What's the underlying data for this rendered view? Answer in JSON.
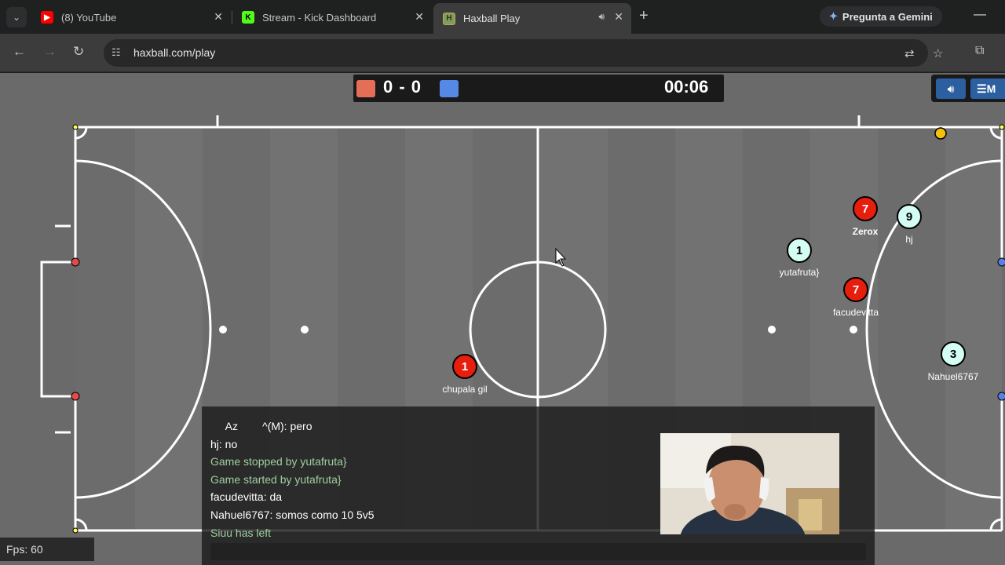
{
  "browser": {
    "tabs": [
      {
        "title": "(8) YouTube",
        "icon": "youtube-icon"
      },
      {
        "title": "Stream - Kick Dashboard",
        "icon": "kick-icon"
      },
      {
        "title": "Haxball Play",
        "icon": "haxball-icon"
      }
    ],
    "gemini_label": "Pregunta a Gemini",
    "url": "haxball.com/play"
  },
  "scoreboard": {
    "score": "0 - 0",
    "time": "00:06",
    "red_color": "#e56e56",
    "blue_color": "#5689e5"
  },
  "menu": {
    "label": "M"
  },
  "players": [
    {
      "number": "1",
      "name": "chupala gil",
      "team": "red"
    },
    {
      "number": "7",
      "name": "Zerox",
      "team": "red"
    },
    {
      "number": "9",
      "name": "hj",
      "team": "blue"
    },
    {
      "number": "1",
      "name": "yutafruta}",
      "team": "blue"
    },
    {
      "number": "7",
      "name": "facudevitta",
      "team": "red"
    },
    {
      "number": "3",
      "name": "Nahuel6767",
      "team": "blue"
    }
  ],
  "chat": {
    "lines": [
      {
        "text": "     Az        ^(M): pero",
        "kind": "msg"
      },
      {
        "text": "hj: no",
        "kind": "msg"
      },
      {
        "text": "Game stopped by yutafruta}",
        "kind": "notice"
      },
      {
        "text": "Game started by yutafruta}",
        "kind": "notice"
      },
      {
        "text": "facudevitta: da",
        "kind": "msg"
      },
      {
        "text": "Nahuel6767: somos como 10 5v5",
        "kind": "msg"
      },
      {
        "text": "Siuu has left",
        "kind": "notice"
      }
    ]
  },
  "fps": "Fps: 60"
}
